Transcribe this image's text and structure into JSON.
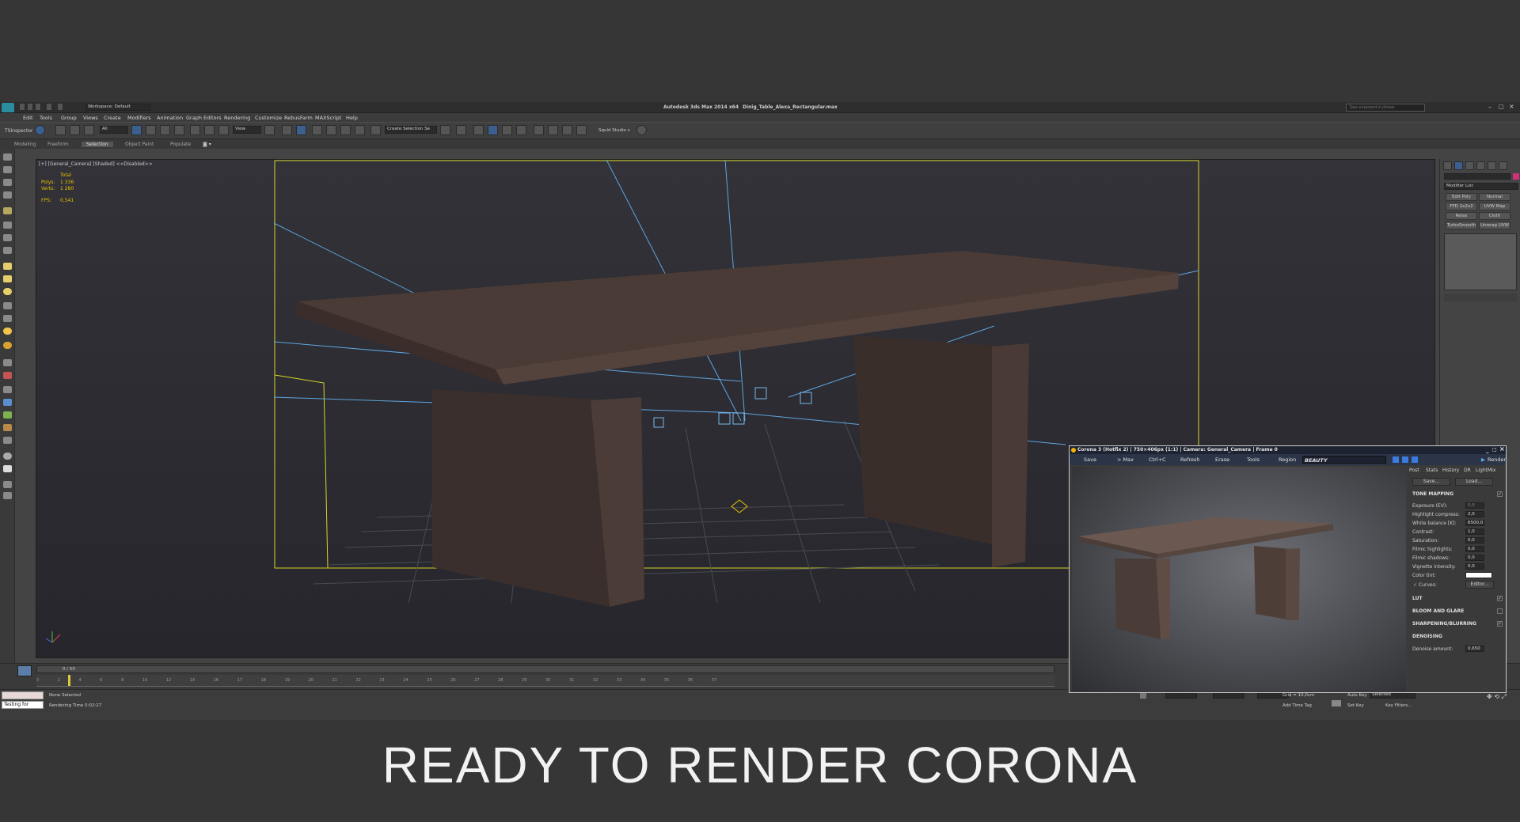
{
  "titlebar": {
    "app_title": "Autodesk 3ds Max  2014 x64",
    "file_name": "Dinig_Table_Alexa_Rectangular.max",
    "workspace": "Workspace: Default",
    "search_placeholder": "Type a keyword or phrase"
  },
  "menu": [
    "Edit",
    "Tools",
    "Group",
    "Views",
    "Create",
    "Modifiers",
    "Animation",
    "Graph Editors",
    "Rendering",
    "Customize",
    "RebusFarm",
    "MAXScript",
    "Help"
  ],
  "toolbar": {
    "inspector": "TSInspector",
    "filter": "All",
    "view": "View",
    "selection_set": "Create Selection Se",
    "squid": "Squid Studio v"
  },
  "ribbon": {
    "tabs": [
      "Modeling",
      "Freeform",
      "Selection",
      "Object Paint",
      "Populate"
    ],
    "active": "Selection"
  },
  "viewport": {
    "label": "[+] [General_Camera] [Shaded] <<Disabled>>",
    "stats": {
      "total": "Total",
      "polys_label": "Polys:",
      "polys": "1 336",
      "verts_label": "Verts:",
      "verts": "1 280",
      "fps_label": "FPS:",
      "fps": "0,541"
    }
  },
  "command_panel": {
    "modifier_list": "Modifier List",
    "buttons": [
      "Edit Poly",
      "Normal",
      "FFD 2x2x2",
      "UVW Map",
      "Relax",
      "Cloth",
      "TurboSmooth",
      "Unwrap UVW"
    ]
  },
  "timeline": {
    "frame": "0 / 50",
    "ticks": [
      "0",
      "2",
      "4",
      "6",
      "8",
      "10",
      "12",
      "14",
      "16",
      "17",
      "18",
      "19",
      "20",
      "21",
      "22",
      "23",
      "24",
      "25",
      "26",
      "27",
      "28",
      "29",
      "30",
      "31",
      "32",
      "33",
      "34",
      "35",
      "36",
      "37"
    ]
  },
  "status": {
    "script_listener": "Testing for",
    "selection": "None Selected",
    "render_time": "Rendering Time  0:02:27",
    "grid": "Grid = 10,0cm",
    "add_time_tag": "Add Time Tag",
    "auto_key": "Auto Key",
    "selected": "Selected",
    "set_key": "Set Key",
    "key_filters": "Key Filters..."
  },
  "corona": {
    "title": "Corona 3 (Hotfix 2) | 750×406px (1:1) | Camera: General_Camera | Frame 0",
    "tools": [
      "Save",
      "> Max",
      "Ctrl+C",
      "Refresh",
      "Erase",
      "Tools",
      "Region",
      "BEAUTY"
    ],
    "render_label": "Render",
    "tabs": [
      "Post",
      "Stats",
      "History",
      "DR",
      "LightMix"
    ],
    "save_btn": "Save...",
    "load_btn": "Load...",
    "tone_mapping": "TONE MAPPING",
    "params": [
      {
        "label": "Exposure (EV):",
        "value": "0,0"
      },
      {
        "label": "Highlight compress:",
        "value": "2,0"
      },
      {
        "label": "White balance [K]:",
        "value": "6500,0"
      },
      {
        "label": "Contrast:",
        "value": "1,0"
      },
      {
        "label": "Saturation:",
        "value": "0,0"
      },
      {
        "label": "Filmic highlights:",
        "value": "0,0"
      },
      {
        "label": "Filmic shadows:",
        "value": "0,0"
      },
      {
        "label": "Vignette intensity:",
        "value": "0,0"
      }
    ],
    "color_tint": "Color tint:",
    "curves": "Curves:",
    "editor": "Editor...",
    "sections": [
      "LUT",
      "BLOOM AND GLARE",
      "SHARPENING/BLURRING",
      "DENOISING"
    ],
    "denoise_label": "Denoise amount:",
    "denoise_value": "0,650"
  },
  "caption": "READY TO RENDER CORONA",
  "colors": {
    "wood": "#3e302c",
    "bg": "#363636",
    "accent": "#e6c200"
  }
}
